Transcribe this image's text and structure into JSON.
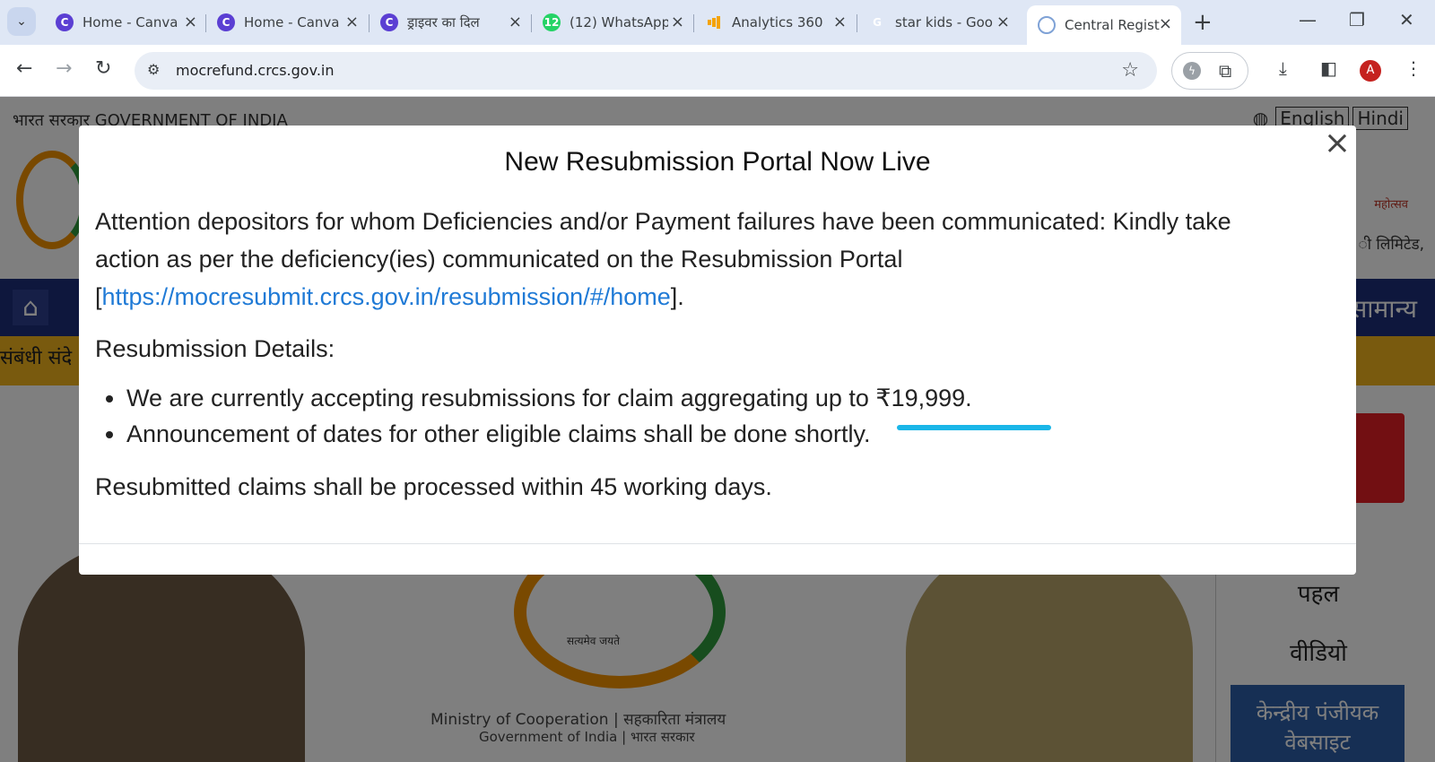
{
  "browser": {
    "tabs": [
      {
        "title": "Home - Canva",
        "favicon": "canva-icon"
      },
      {
        "title": "Home - Canva",
        "favicon": "canva-icon"
      },
      {
        "title": "ड्राइवर का दिल",
        "favicon": "canva-icon"
      },
      {
        "title": "(12) WhatsApp",
        "favicon": "whatsapp-icon",
        "badge": "12"
      },
      {
        "title": "Analytics 360",
        "favicon": "analytics-icon"
      },
      {
        "title": "star kids - Goo",
        "favicon": "google-icon"
      },
      {
        "title": "Central Regist",
        "favicon": "document-icon",
        "active": true
      }
    ],
    "url": "mocrefund.crcs.gov.in",
    "profile_initial": "A"
  },
  "site": {
    "gov_text": "भारत सरकार  GOVERNMENT OF INDIA",
    "lang_english": "English",
    "lang_hindi": "Hindi",
    "right_hindi": "ी लिमिटेड,",
    "mahotsav": "महोत्सव",
    "nav_right": "सामान्य",
    "yellow_left": "संबंधी संदे",
    "side_link_1": "पहल",
    "side_link_2": "वीडियो",
    "side_blue": "केन्द्रीय पंजीयक वेबसाइट",
    "emblem_motto": "सत्यमेव जयते",
    "ministry": "Ministry of Cooperation | सहकारिता मंत्रालय",
    "ministry_sub": "Government of India | भारत सरकार"
  },
  "modal": {
    "title": "New Resubmission Portal Now Live",
    "attention_text": "Attention depositors for whom Deficiencies and/or Payment failures have been communicated: Kindly take action as per the deficiency(ies) communicated on the Resubmission Portal",
    "link_open": "[",
    "link": "https://mocresubmit.crcs.gov.in/resubmission/#/home",
    "link_close": "].",
    "details_heading": "Resubmission Details:",
    "bullets": [
      "We are currently accepting resubmissions for claim aggregating up to ₹19,999.",
      "Announcement of dates for other eligible claims shall be done shortly."
    ],
    "processed_text": "Resubmitted claims shall be processed within 45 working days.",
    "close_symbol": "×"
  },
  "colors": {
    "link": "#1f7ad6",
    "highlight": "#1ab6e8",
    "navbar": "#1c2f7a",
    "yellowbar": "#f2b41c"
  }
}
